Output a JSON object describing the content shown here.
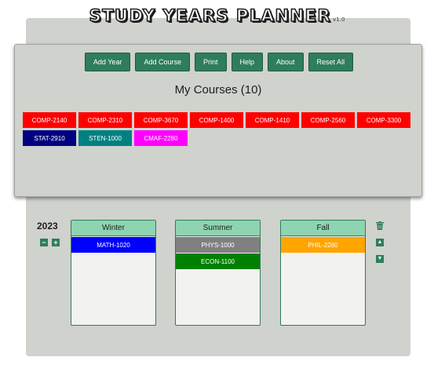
{
  "app": {
    "title": "STUDY YEARS PLANNER",
    "version": "v1.0"
  },
  "toolbar": {
    "buttons": [
      "Add Year",
      "Add Course",
      "Print",
      "Help",
      "About",
      "Reset All"
    ]
  },
  "courses": {
    "heading": "My Courses (10)",
    "items": [
      {
        "code": "COMP-2140",
        "color": "#ff0000"
      },
      {
        "code": "COMP-2310",
        "color": "#ff0000"
      },
      {
        "code": "COMP-3670",
        "color": "#ff0000"
      },
      {
        "code": "COMP-1400",
        "color": "#ff0000"
      },
      {
        "code": "COMP-1410",
        "color": "#ff0000"
      },
      {
        "code": "COMP-2560",
        "color": "#ff0000"
      },
      {
        "code": "COMP-3300",
        "color": "#ff0000"
      },
      {
        "code": "STAT-2910",
        "color": "#000080"
      },
      {
        "code": "STEN-1000",
        "color": "#008080"
      },
      {
        "code": "CMAF-2280",
        "color": "#ff00ff"
      }
    ]
  },
  "year": {
    "label": "2023",
    "minus": "−",
    "plus": "+",
    "semesters": [
      {
        "name": "Winter",
        "courses": [
          {
            "code": "MATH-1020",
            "color": "#0000ff"
          }
        ]
      },
      {
        "name": "Summer",
        "courses": [
          {
            "code": "PHYS-1000",
            "color": "#808080"
          },
          {
            "code": "ECON-1100",
            "color": "#008000"
          }
        ]
      },
      {
        "name": "Fall",
        "courses": [
          {
            "code": "PHIL-2280",
            "color": "#ffa500"
          }
        ]
      }
    ],
    "controls": {
      "delete_icon": "trash-icon",
      "up_icon": "triangle-up-icon",
      "down_icon": "triangle-down-icon"
    }
  },
  "colors": {
    "accent": "#2e7d5b",
    "semester_header": "#8fd4b1",
    "panel": "#d0d2cd"
  }
}
